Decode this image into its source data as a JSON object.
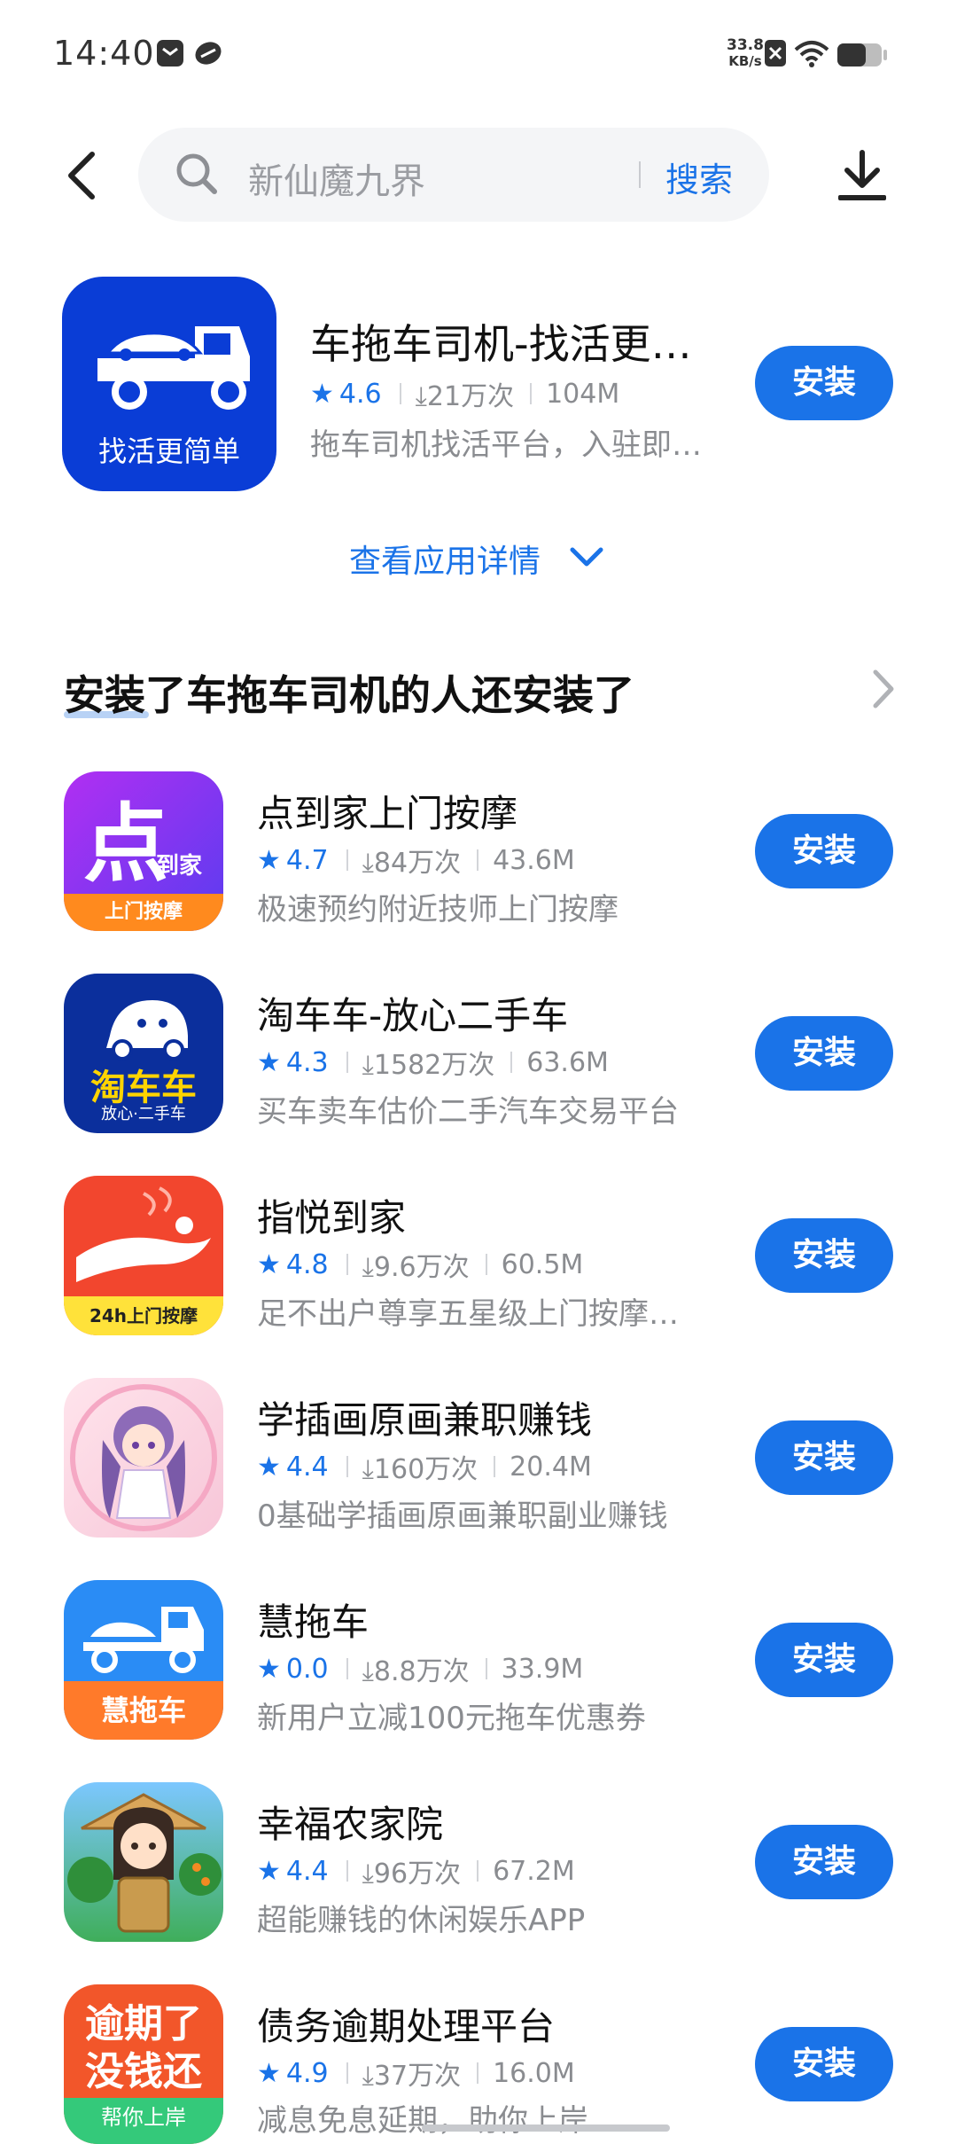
{
  "status_bar": {
    "time": "14:40",
    "net_speed_value": "33.8",
    "net_speed_unit": "KB/s"
  },
  "header": {
    "search_placeholder": "新仙魔九界",
    "search_button": "搜索"
  },
  "featured": {
    "name": "车拖车司机-找活更…",
    "rating": "4.6",
    "downloads": "21万次",
    "size": "104M",
    "description": "拖车司机找活平台，入驻即…",
    "icon_text": "找活更简单",
    "install_label": "安装",
    "details_link": "查看应用详情"
  },
  "section": {
    "title": "安装了车拖车司机的人还安装了"
  },
  "apps": [
    {
      "name": "点到家上门按摩",
      "rating": "4.7",
      "downloads": "84万次",
      "size": "43.6M",
      "description": "极速预约附近技师上门按摩",
      "install_label": "安装",
      "icon_big": "点",
      "icon_small": "到家",
      "icon_bottom": "上门按摩"
    },
    {
      "name": "淘车车-放心二手车",
      "rating": "4.3",
      "downloads": "1582万次",
      "size": "63.6M",
      "description": "买车卖车估价二手汽车交易平台",
      "install_label": "安装",
      "icon_big": "淘车车",
      "icon_bottom": "放心·二手车"
    },
    {
      "name": "指悦到家",
      "rating": "4.8",
      "downloads": "9.6万次",
      "size": "60.5M",
      "description": "足不出户尊享五星级上门按摩…",
      "install_label": "安装",
      "icon_bottom": "24h上门按摩"
    },
    {
      "name": "学插画原画兼职赚钱",
      "rating": "4.4",
      "downloads": "160万次",
      "size": "20.4M",
      "description": "0基础学插画原画兼职副业赚钱",
      "install_label": "安装"
    },
    {
      "name": "慧拖车",
      "rating": "0.0",
      "downloads": "8.8万次",
      "size": "33.9M",
      "description": "新用户立减100元拖车优惠券",
      "install_label": "安装",
      "icon_bottom": "慧拖车"
    },
    {
      "name": "幸福农家院",
      "rating": "4.4",
      "downloads": "96万次",
      "size": "67.2M",
      "description": "超能赚钱的休闲娱乐APP",
      "install_label": "安装"
    },
    {
      "name": "债务逾期处理平台",
      "rating": "4.9",
      "downloads": "37万次",
      "size": "16.0M",
      "description": "减息免息延期，助你上岸",
      "install_label": "安装",
      "icon_line1": "逾期了",
      "icon_line2": "没钱还",
      "icon_bottom": "帮你上岸"
    }
  ],
  "colors": {
    "accent": "#1a73e8",
    "background": "#ffffff",
    "secondary_text": "#8a8c90"
  }
}
